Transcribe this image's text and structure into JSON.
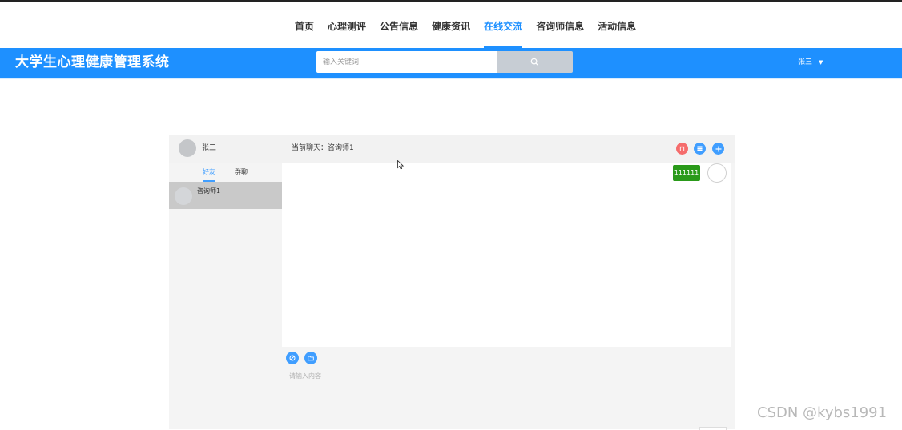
{
  "nav": {
    "items": [
      "首页",
      "心理测评",
      "公告信息",
      "健康资讯",
      "在线交流",
      "咨询师信息",
      "活动信息"
    ],
    "active": "在线交流"
  },
  "header": {
    "title": "大学生心理健康管理系统",
    "search_placeholder": "输入关键词",
    "user_name": "张三"
  },
  "chat": {
    "me_name": "张三",
    "current_label": "当前聊天：咨询师1",
    "tabs": {
      "friends": "好友",
      "groups": "群聊"
    },
    "contacts": [
      {
        "name": "咨询师1"
      }
    ],
    "messages": [
      {
        "text": "111111",
        "from": "me"
      }
    ],
    "input_placeholder": "请输入内容"
  },
  "colors": {
    "primary": "#1E90FF",
    "accent": "#409eff",
    "danger": "#f56c6c",
    "bubble": "#2a9a1a"
  },
  "watermark": "CSDN @kybs1991"
}
